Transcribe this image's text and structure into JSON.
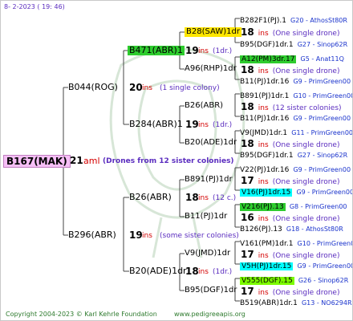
{
  "header_date": "8-  2-2023 ( 19: 46)",
  "root": {
    "label": "B167(MAK)",
    "num": "21",
    "ins": "aml",
    "note": "(Drones from 12 sister colonies)"
  },
  "g1": [
    {
      "label": "B044(ROG)",
      "num": "20",
      "ins": "ins",
      "note": "(1 single colony)"
    },
    {
      "label": "B296(ABR)",
      "num": "19",
      "ins": "ins",
      "note": "(some sister colonies)"
    }
  ],
  "g2": [
    {
      "label": "B471(ABR)1",
      "num": "19",
      "ins": "ins",
      "note": "(1dr.)"
    },
    {
      "label": "B284(ABR)1",
      "num": "19",
      "ins": "ins",
      "note": "(1dr.)"
    },
    {
      "label": "B26(ABR)",
      "num": "18",
      "ins": "ins",
      "note": "(12 c.)"
    },
    {
      "label": "B20(ADE)1dr",
      "num": "18",
      "ins": "ins",
      "note": "(1dr.)"
    }
  ],
  "g3": [
    {
      "label": "B28(SAW)1dr",
      "num": "18",
      "ins": "ins",
      "note": "(One single drone)"
    },
    {
      "label": "A96(RHP)1dr",
      "num": "19",
      "ins": "ins",
      "note": "(1dr.)"
    },
    {
      "label": "B26(ABR)",
      "num": "18",
      "ins": "ins",
      "note": "(12 sister colonies)"
    },
    {
      "label": "B20(ADE)1dr",
      "num": "18",
      "ins": "ins",
      "note": "(One single drone)"
    },
    {
      "label": "B891(PJ)1dr",
      "num": "17",
      "ins": "ins",
      "note": "(One single drone)"
    },
    {
      "label": "B11(PJ)1dr",
      "num": "16",
      "ins": "ins",
      "note": "(One single drone)"
    },
    {
      "label": "V9(JMD)1dr",
      "num": "17",
      "ins": "ins",
      "note": "(One single drone)"
    },
    {
      "label": "B95(DGF)1dr",
      "num": "17",
      "ins": "ins",
      "note": "(One single drone)"
    }
  ],
  "g4": [
    {
      "label": "B282F1(PJ).1",
      "sr": "G20 - AthosSt80R"
    },
    {
      "label": "B95(DGF)1dr.1",
      "sr": "G27 - Sinop62R"
    },
    {
      "label": "A12(PM)3dr.17",
      "sr": "G5 - Anat11Q"
    },
    {
      "label": "B11(PJ)1dr.16",
      "sr": "G9 - PrimGreen00"
    },
    {
      "label": "B891(PJ)1dr.1",
      "sr": "G10 - PrimGreen00"
    },
    {
      "label": "B11(PJ)1dr.16",
      "sr": "G9 - PrimGreen00"
    },
    {
      "label": "V9(JMD)1dr.1",
      "sr": "G11 - PrimGreen00"
    },
    {
      "label": "B95(DGF)1dr.1",
      "sr": "G27 - Sinop62R"
    },
    {
      "label": "V22(PJ)1dr.16",
      "sr": "G9 - PrimGreen00"
    },
    {
      "label": "V16(PJ)1dr.15",
      "sr": "G9 - PrimGreen00"
    },
    {
      "label": "V216(PJ).13",
      "sr": "G8 - PrimGreen00"
    },
    {
      "label": "B126(PJ).13",
      "sr": "G18 - AthosSt80R"
    },
    {
      "label": "V161(PM)1dr.1",
      "sr": "G10 - PrimGreen00"
    },
    {
      "label": "V5H(PJ)1dr.15",
      "sr": "G9 - PrimGreen00"
    },
    {
      "label": "V555(DGF).15",
      "sr": "G26 - Sinop62R"
    },
    {
      "label": "B519(ABR)1dr.1",
      "sr": "G13 - NO6294R"
    }
  ],
  "g4_mid": [
    {
      "num": "18",
      "ins": "ins",
      "note": "(One single drone)"
    },
    {
      "num": "18",
      "ins": "ins",
      "note": "(One single drone)"
    },
    {
      "num": "18",
      "ins": "ins",
      "note": "(12 sister colonies)"
    },
    {
      "num": "18",
      "ins": "ins",
      "note": "(One single drone)"
    },
    {
      "num": "17",
      "ins": "ins",
      "note": "(One single drone)"
    },
    {
      "num": "16",
      "ins": "ins",
      "note": "(One single drone)"
    },
    {
      "num": "17",
      "ins": "ins",
      "note": "(One single drone)"
    },
    {
      "num": "17",
      "ins": "ins",
      "note": "(One single drone)"
    }
  ],
  "footer": {
    "copyright": "Copyright 2004-2023 © Karl Kehrle Foundation",
    "site": "www.pedigreeapis.org"
  }
}
